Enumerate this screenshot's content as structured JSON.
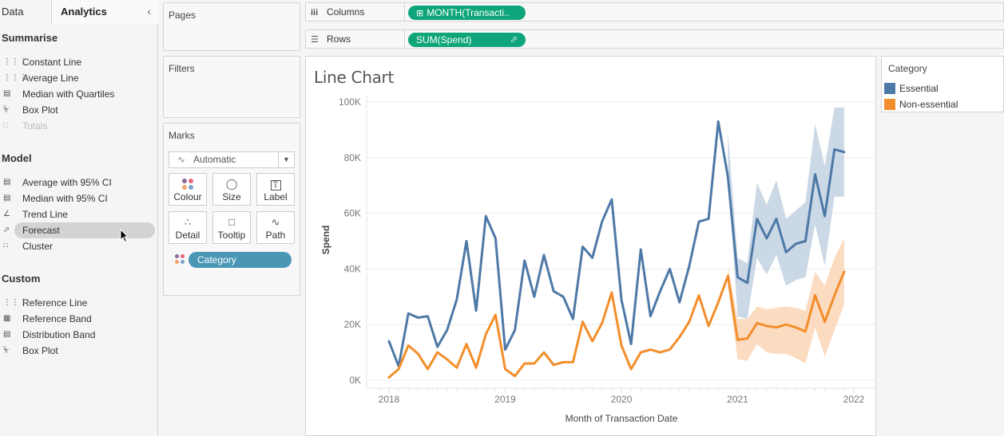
{
  "sidebar": {
    "tabs": [
      {
        "label": "Data"
      },
      {
        "label": "Analytics"
      }
    ],
    "collapse_icon": "chevron-left-icon",
    "sections": [
      {
        "title": "Summarise",
        "items": [
          {
            "label": "Constant Line",
            "icon": "reference-line-icon",
            "disabled": false
          },
          {
            "label": "Average Line",
            "icon": "reference-line-icon",
            "disabled": false
          },
          {
            "label": "Median with Quartiles",
            "icon": "distribution-band-icon",
            "disabled": false
          },
          {
            "label": "Box Plot",
            "icon": "box-plot-icon",
            "disabled": false
          },
          {
            "label": "Totals",
            "icon": "totals-icon",
            "disabled": true
          }
        ]
      },
      {
        "title": "Model",
        "items": [
          {
            "label": "Average with 95% CI",
            "icon": "distribution-band-icon",
            "disabled": false
          },
          {
            "label": "Median with 95% CI",
            "icon": "distribution-band-icon",
            "disabled": false
          },
          {
            "label": "Trend Line",
            "icon": "trend-line-icon",
            "disabled": false
          },
          {
            "label": "Forecast",
            "icon": "forecast-icon",
            "disabled": false,
            "hovered": true
          },
          {
            "label": "Cluster",
            "icon": "cluster-icon",
            "disabled": false
          }
        ]
      },
      {
        "title": "Custom",
        "items": [
          {
            "label": "Reference Line",
            "icon": "reference-line-icon",
            "disabled": false
          },
          {
            "label": "Reference Band",
            "icon": "reference-band-icon",
            "disabled": false
          },
          {
            "label": "Distribution Band",
            "icon": "distribution-band-icon",
            "disabled": false
          },
          {
            "label": "Box Plot",
            "icon": "box-plot-icon",
            "disabled": false
          }
        ]
      }
    ]
  },
  "cards": {
    "pages": "Pages",
    "filters": "Filters",
    "marks": {
      "title": "Marks",
      "type": "Automatic",
      "buttons": [
        {
          "label": "Colour",
          "icon": "colour-icon"
        },
        {
          "label": "Size",
          "icon": "size-icon"
        },
        {
          "label": "Label",
          "icon": "label-icon"
        },
        {
          "label": "Detail",
          "icon": "detail-icon"
        },
        {
          "label": "Tooltip",
          "icon": "tooltip-icon"
        },
        {
          "label": "Path",
          "icon": "path-icon"
        }
      ],
      "field_pill": "Category"
    }
  },
  "shelves": {
    "columns": {
      "label": "Columns",
      "pill": "MONTH(Transacti.."
    },
    "rows": {
      "label": "Rows",
      "pill": "SUM(Spend)"
    }
  },
  "legend": {
    "title": "Category",
    "items": [
      {
        "label": "Essential",
        "color": "#4e79a7"
      },
      {
        "label": "Non-essential",
        "color": "#f28e2b"
      }
    ]
  },
  "colors": {
    "pill_green": "#0fa57b",
    "pill_blue": "#4a97b5",
    "essential": "#4e79a7",
    "non_essential": "#f28e2b"
  },
  "chart_data": {
    "type": "line",
    "title": "Line Chart",
    "xlabel": "Month of Transaction Date",
    "ylabel": "Spend",
    "x_tick_labels": [
      "2018",
      "2019",
      "2020",
      "2021",
      "2022"
    ],
    "y_tick_labels": [
      "0K",
      "20K",
      "40K",
      "60K",
      "80K",
      "100K"
    ],
    "ylim": [
      0,
      100000
    ],
    "xlim": [
      "2018-01",
      "2022-01"
    ],
    "grid": true,
    "legend_position": "right",
    "x": [
      "2018-01",
      "2018-02",
      "2018-03",
      "2018-04",
      "2018-05",
      "2018-06",
      "2018-07",
      "2018-08",
      "2018-09",
      "2018-10",
      "2018-11",
      "2018-12",
      "2019-01",
      "2019-02",
      "2019-03",
      "2019-04",
      "2019-05",
      "2019-06",
      "2019-07",
      "2019-08",
      "2019-09",
      "2019-10",
      "2019-11",
      "2019-12",
      "2020-01",
      "2020-02",
      "2020-03",
      "2020-04",
      "2020-05",
      "2020-06",
      "2020-07",
      "2020-08",
      "2020-09",
      "2020-10",
      "2020-11",
      "2020-12",
      "2021-01",
      "2021-02",
      "2021-03",
      "2021-04",
      "2021-05",
      "2021-06",
      "2021-07",
      "2021-08",
      "2021-09",
      "2021-10",
      "2021-11",
      "2021-12"
    ],
    "forecast_start": "2021-01",
    "series": [
      {
        "name": "Essential",
        "color": "#4e79a7",
        "values": [
          14000,
          5000,
          24000,
          22500,
          23000,
          12000,
          18000,
          29000,
          50000,
          25000,
          59000,
          51000,
          11000,
          18000,
          43000,
          30000,
          45000,
          32000,
          30000,
          22000,
          48000,
          44000,
          57000,
          65000,
          29000,
          13000,
          47000,
          23000,
          32000,
          40000,
          28000,
          41000,
          57000,
          58000,
          93000,
          73000,
          37000,
          35000,
          58000,
          51000,
          58000,
          46000,
          49000,
          50000,
          74000,
          59000,
          83000,
          82000
        ],
        "forecast_upper": [
          null,
          null,
          null,
          null,
          null,
          null,
          null,
          null,
          null,
          null,
          null,
          null,
          null,
          null,
          null,
          null,
          null,
          null,
          null,
          null,
          null,
          null,
          null,
          null,
          null,
          null,
          null,
          null,
          null,
          null,
          null,
          null,
          null,
          null,
          null,
          89000,
          44000,
          42000,
          71000,
          63000,
          72000,
          58000,
          61000,
          64000,
          92000,
          77000,
          98000,
          98000
        ],
        "forecast_lower": [
          null,
          null,
          null,
          null,
          null,
          null,
          null,
          null,
          null,
          null,
          null,
          null,
          null,
          null,
          null,
          null,
          null,
          null,
          null,
          null,
          null,
          null,
          null,
          null,
          null,
          null,
          null,
          null,
          null,
          null,
          null,
          null,
          null,
          null,
          null,
          73000,
          23000,
          22000,
          44000,
          38000,
          45000,
          34000,
          36000,
          37000,
          56000,
          41000,
          66000,
          66000
        ]
      },
      {
        "name": "Non-essential",
        "color": "#f28e2b",
        "values": [
          1000,
          4000,
          12500,
          9500,
          4000,
          10000,
          7500,
          4500,
          13000,
          4500,
          16500,
          23500,
          4000,
          1500,
          6000,
          6000,
          10000,
          5500,
          6500,
          6500,
          21000,
          14000,
          20500,
          31500,
          12500,
          4000,
          10000,
          11000,
          10000,
          11000,
          15500,
          21000,
          30500,
          19500,
          28000,
          37500,
          14500,
          15000,
          20500,
          19500,
          19000,
          20000,
          19000,
          17500,
          30500,
          21000,
          30500,
          39000
        ],
        "forecast_upper": [
          null,
          null,
          null,
          null,
          null,
          null,
          null,
          null,
          null,
          null,
          null,
          null,
          null,
          null,
          null,
          null,
          null,
          null,
          null,
          null,
          null,
          null,
          null,
          null,
          null,
          null,
          null,
          null,
          null,
          null,
          null,
          null,
          null,
          null,
          null,
          41000,
          22000,
          22000,
          26500,
          25500,
          26000,
          26500,
          26000,
          25000,
          39000,
          34000,
          44000,
          51000
        ],
        "forecast_lower": [
          null,
          null,
          null,
          null,
          null,
          null,
          null,
          null,
          null,
          null,
          null,
          null,
          null,
          null,
          null,
          null,
          null,
          null,
          null,
          null,
          null,
          null,
          null,
          null,
          null,
          null,
          null,
          null,
          null,
          null,
          null,
          null,
          null,
          null,
          null,
          34000,
          7500,
          7000,
          13000,
          10000,
          9500,
          9500,
          8000,
          6000,
          19000,
          8500,
          18000,
          27000
        ]
      }
    ]
  }
}
